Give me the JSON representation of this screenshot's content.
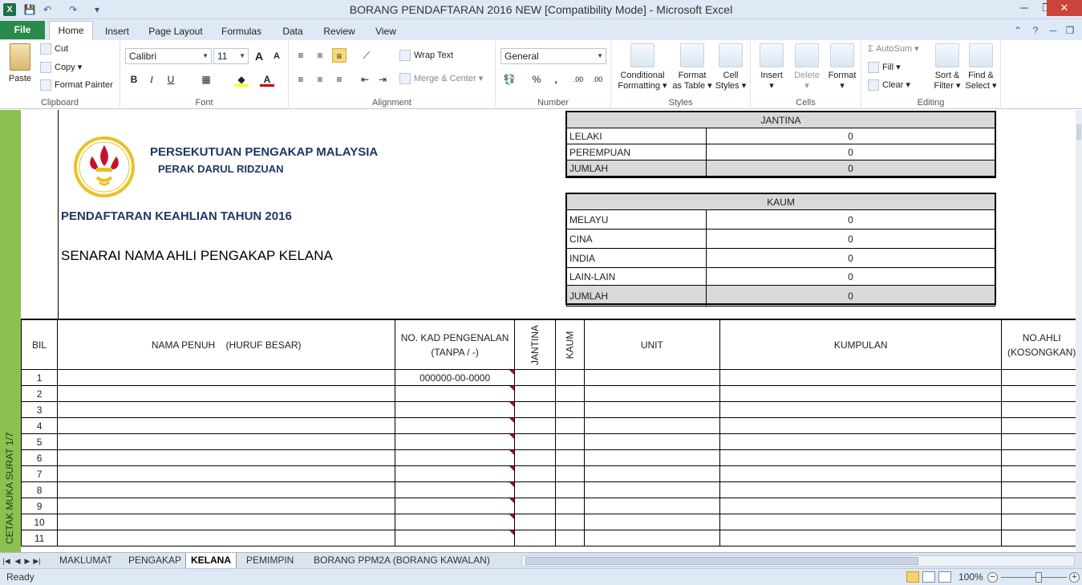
{
  "window": {
    "title": "BORANG PENDAFTARAN 2016 NEW  [Compatibility Mode]  -  Microsoft Excel",
    "app_icon": "X",
    "controls": [
      "─",
      "❐",
      "✕"
    ]
  },
  "quick_access": {
    "save_icon": "💾",
    "undo_icon": "↶",
    "redo_icon": "↷",
    "customize_icon": "▾"
  },
  "tabs": {
    "file": "File",
    "items": [
      "Home",
      "Insert",
      "Page Layout",
      "Formulas",
      "Data",
      "Review",
      "View"
    ],
    "active": "Home",
    "right_icons": [
      "⌃",
      "?",
      "─",
      "❐"
    ]
  },
  "ribbon": {
    "clipboard": {
      "label": "Clipboard",
      "paste": "Paste",
      "cut": "Cut",
      "copy": "Copy",
      "format_painter": "Format Painter"
    },
    "font": {
      "label": "Font",
      "name": "Calibri",
      "size": "11",
      "grow": "A",
      "shrink": "A",
      "bold": "B",
      "italic": "I",
      "underline": "U"
    },
    "alignment": {
      "label": "Alignment",
      "wrap_text": "Wrap Text",
      "merge_center": "Merge & Center"
    },
    "number": {
      "label": "Number",
      "format": "General",
      "percent": "%",
      "comma": ",",
      "inc_decimal": ".00",
      "dec_decimal": ".00"
    },
    "styles": {
      "label": "Styles",
      "conditional": [
        "Conditional",
        "Formatting"
      ],
      "format_table": [
        "Format",
        "as Table"
      ],
      "cell_styles": [
        "Cell",
        "Styles"
      ]
    },
    "cells": {
      "label": "Cells",
      "insert": "Insert",
      "delete": "Delete",
      "format": "Format"
    },
    "editing": {
      "label": "Editing",
      "autosum": "AutoSum",
      "fill": "Fill",
      "clear": "Clear",
      "sort_filter": [
        "Sort &",
        "Filter"
      ],
      "find_select": [
        "Find &",
        "Select"
      ]
    }
  },
  "sheet": {
    "side_label": "CETAK MUKA SURAT 1/7",
    "org_name": "PERSEKUTUAN PENGAKAP MALAYSIA",
    "org_state": "PERAK DARUL RIDZUAN",
    "registration_title": "PENDAFTARAN KEAHLIAN TAHUN 2016",
    "list_title": "SENARAI NAMA AHLI PENGAKAP KELANA",
    "jantina": {
      "header": "JANTINA",
      "rows": [
        {
          "label": "LELAKI",
          "value": "0"
        },
        {
          "label": "PEREMPUAN",
          "value": "0"
        },
        {
          "label": "JUMLAH",
          "value": "0"
        }
      ]
    },
    "kaum": {
      "header": "KAUM",
      "rows": [
        {
          "label": "MELAYU",
          "value": "0"
        },
        {
          "label": "CINA",
          "value": "0"
        },
        {
          "label": "INDIA",
          "value": "0"
        },
        {
          "label": "LAIN-LAIN",
          "value": "0"
        },
        {
          "label": "JUMLAH",
          "value": "0"
        }
      ]
    },
    "columns": {
      "bil": "BIL",
      "nama": "NAMA PENUH    (HURUF BESAR)",
      "kad_line1": "NO. KAD PENGENALAN",
      "kad_line2": "(TANPA / -)",
      "jantina": "JANTINA",
      "kaum": "KAUM",
      "unit": "UNIT",
      "kumpulan": "KUMPULAN",
      "noahli_line1": "NO.AHLI",
      "noahli_line2": "(KOSONGKAN)"
    },
    "rows": [
      {
        "bil": "1",
        "kad": "000000-00-0000"
      },
      {
        "bil": "2",
        "kad": ""
      },
      {
        "bil": "3",
        "kad": ""
      },
      {
        "bil": "4",
        "kad": ""
      },
      {
        "bil": "5",
        "kad": ""
      },
      {
        "bil": "6",
        "kad": ""
      },
      {
        "bil": "7",
        "kad": ""
      },
      {
        "bil": "8",
        "kad": ""
      },
      {
        "bil": "9",
        "kad": ""
      },
      {
        "bil": "10",
        "kad": ""
      },
      {
        "bil": "11",
        "kad": ""
      }
    ]
  },
  "sheet_tabs": {
    "items": [
      "MAKLUMAT",
      "PENGAKAP",
      "KELANA",
      "PEMIMPIN",
      "BORANG PPM2A (BORANG KAWALAN)"
    ],
    "active": "KELANA"
  },
  "status": {
    "ready": "Ready",
    "zoom": "100%",
    "zoom_out": "−",
    "zoom_in": "+"
  }
}
